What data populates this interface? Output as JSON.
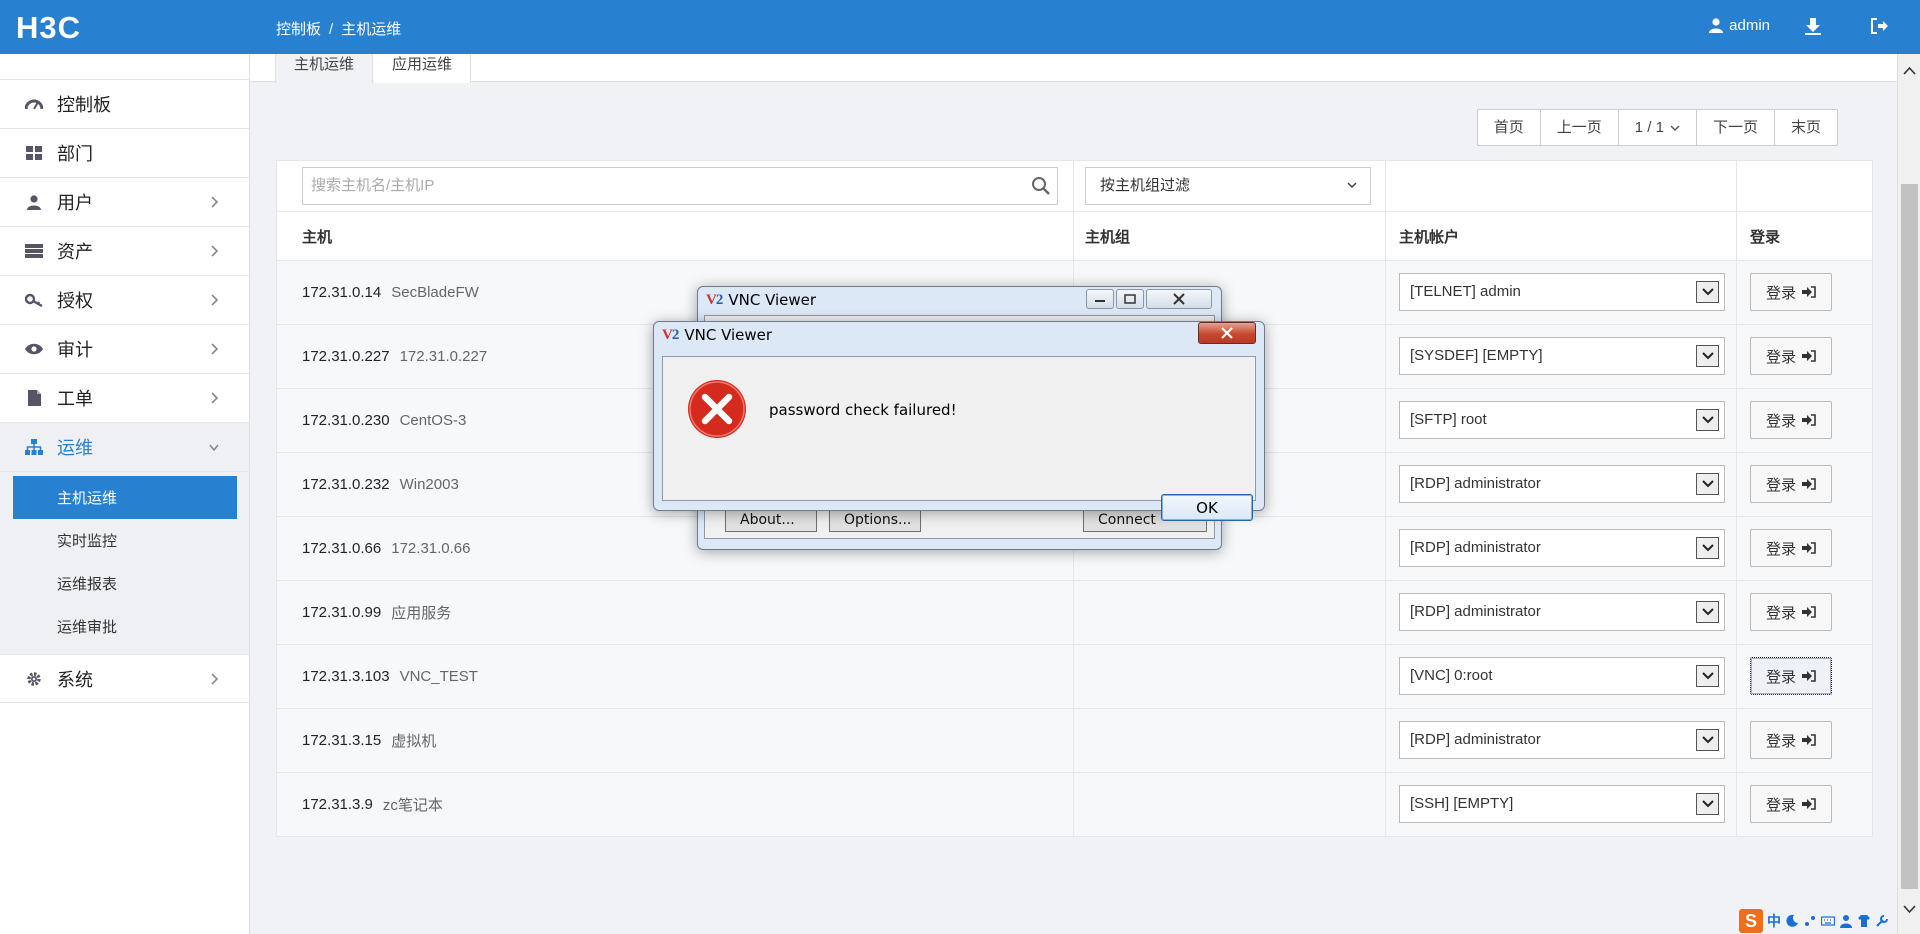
{
  "brand": "H3C",
  "breadcrumb": {
    "home": "控制板",
    "separator": "/",
    "current": "主机运维"
  },
  "user": {
    "name": "admin"
  },
  "sidebar": {
    "items": [
      {
        "label": "控制板",
        "icon": "dashboard-icon",
        "chevron": false
      },
      {
        "label": "部门",
        "icon": "grid-icon",
        "chevron": false
      },
      {
        "label": "用户",
        "icon": "user-icon",
        "chevron": true
      },
      {
        "label": "资产",
        "icon": "server-icon",
        "chevron": true
      },
      {
        "label": "授权",
        "icon": "key-icon",
        "chevron": true
      },
      {
        "label": "审计",
        "icon": "eye-icon",
        "chevron": true
      },
      {
        "label": "工单",
        "icon": "document-icon",
        "chevron": true
      },
      {
        "label": "运维",
        "icon": "sitemap-icon",
        "chevron": true,
        "expanded": true
      },
      {
        "label": "系统",
        "icon": "gear-icon",
        "chevron": true
      }
    ],
    "submenu": [
      {
        "label": "主机运维",
        "active": true
      },
      {
        "label": "实时监控",
        "active": false
      },
      {
        "label": "运维报表",
        "active": false
      },
      {
        "label": "运维审批",
        "active": false
      }
    ]
  },
  "tabs": [
    {
      "label": "主机运维",
      "active": true
    },
    {
      "label": "应用运维",
      "active": false
    }
  ],
  "pager": {
    "first": "首页",
    "prev": "上一页",
    "current": "1 / 1",
    "next": "下一页",
    "last": "末页"
  },
  "filters": {
    "search_placeholder": "搜索主机名/主机IP",
    "group_filter": "按主机组过滤"
  },
  "table": {
    "headers": {
      "host": "主机",
      "group": "主机组",
      "account": "主机帐户",
      "login": "登录"
    },
    "login_label": "登录",
    "rows": [
      {
        "ip": "172.31.0.14",
        "name": "SecBladeFW",
        "account": "[TELNET] admin"
      },
      {
        "ip": "172.31.0.227",
        "name": "172.31.0.227",
        "account": "[SYSDEF] [EMPTY]"
      },
      {
        "ip": "172.31.0.230",
        "name": "CentOS-3",
        "account": "[SFTP] root"
      },
      {
        "ip": "172.31.0.232",
        "name": "Win2003",
        "account": "[RDP] administrator"
      },
      {
        "ip": "172.31.0.66",
        "name": "172.31.0.66",
        "account": "[RDP] administrator"
      },
      {
        "ip": "172.31.0.99",
        "name": "应用服务",
        "account": "[RDP] administrator"
      },
      {
        "ip": "172.31.3.103",
        "name": "VNC_TEST",
        "account": "[VNC] 0:root",
        "focused": true
      },
      {
        "ip": "172.31.3.15",
        "name": "虚拟机",
        "account": "[RDP] administrator"
      },
      {
        "ip": "172.31.3.9",
        "name": "zc笔记本",
        "account": "[SSH] [EMPTY]"
      }
    ]
  },
  "vnc_back": {
    "title": "VNC Viewer",
    "buttons": {
      "about": "About...",
      "options": "Options...",
      "connect": "Connect"
    }
  },
  "vnc_error": {
    "title": "VNC Viewer",
    "message": "password check failured!",
    "ok": "OK"
  },
  "tray": {
    "ime": "中"
  },
  "colors": {
    "primary": "#2780d0",
    "error": "#d52a1e"
  }
}
